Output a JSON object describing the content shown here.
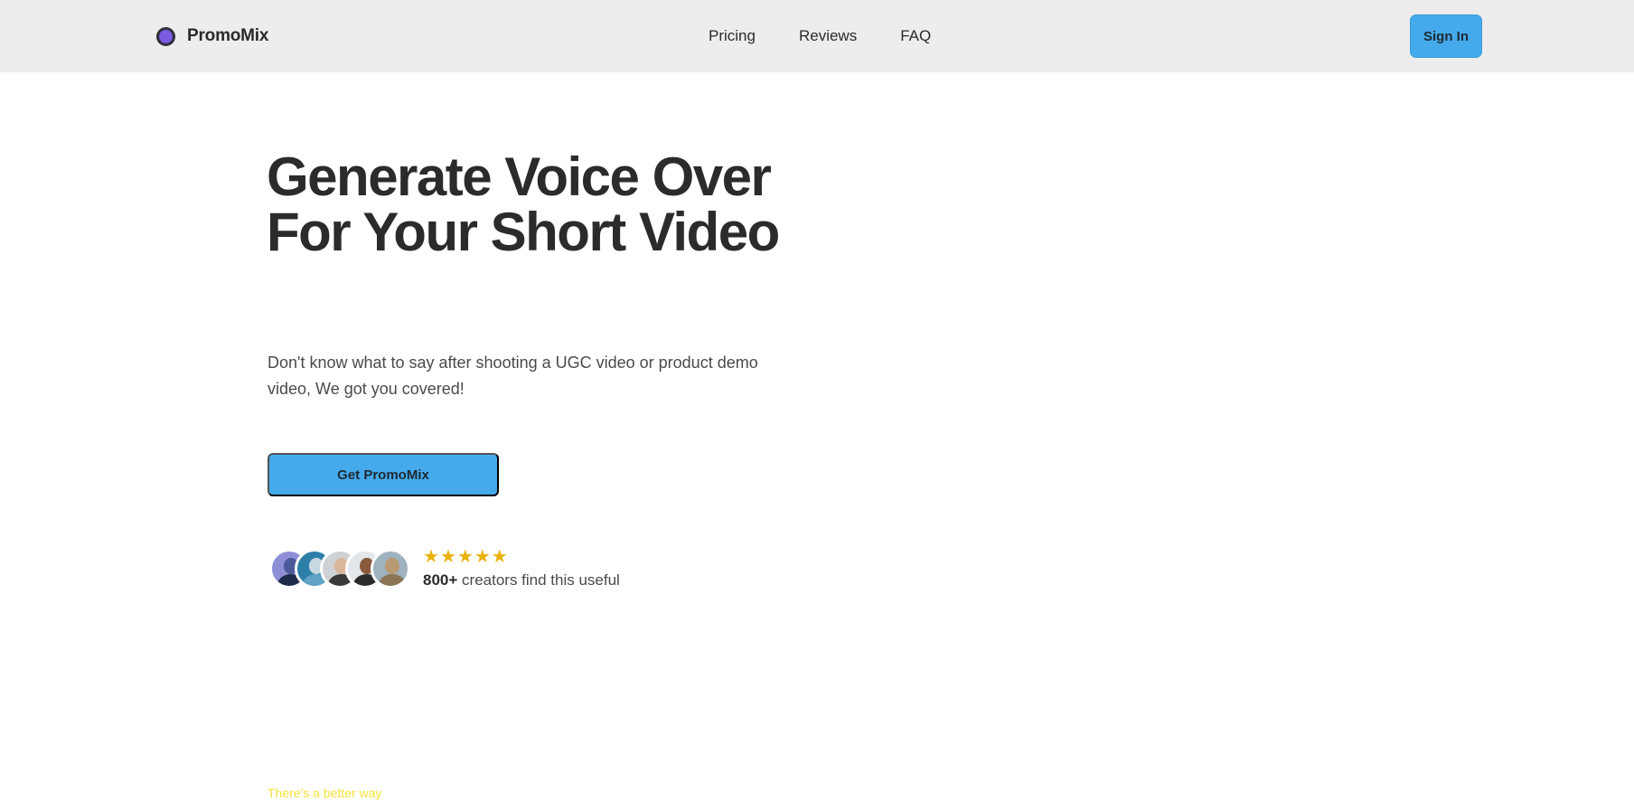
{
  "header": {
    "brand_name": "PromoMix",
    "logo_icon": "circle-logo-icon",
    "nav": [
      {
        "label": "Pricing"
      },
      {
        "label": "Reviews"
      },
      {
        "label": "FAQ"
      }
    ],
    "sign_in_label": "Sign In"
  },
  "hero": {
    "title": "Generate Voice Over For Your Short Video",
    "subtitle": "Don't know what to say after shooting a UGC video or product demo video, We got you covered!",
    "cta_label": "Get PromoMix"
  },
  "social_proof": {
    "star_count": 5,
    "star_glyph": "★",
    "count_label": "800+",
    "text": "creators find this useful",
    "avatars": [
      {
        "name": "avatar-1"
      },
      {
        "name": "avatar-2"
      },
      {
        "name": "avatar-3"
      },
      {
        "name": "avatar-4"
      },
      {
        "name": "avatar-5"
      }
    ]
  },
  "next_section": {
    "eyebrow": "There's a better way"
  },
  "colors": {
    "accent": "#45aaec",
    "nav_bg": "#ededed",
    "star": "#e8b20c",
    "eyebrow": "#f2e23c",
    "logo": "#7a5ae0"
  }
}
